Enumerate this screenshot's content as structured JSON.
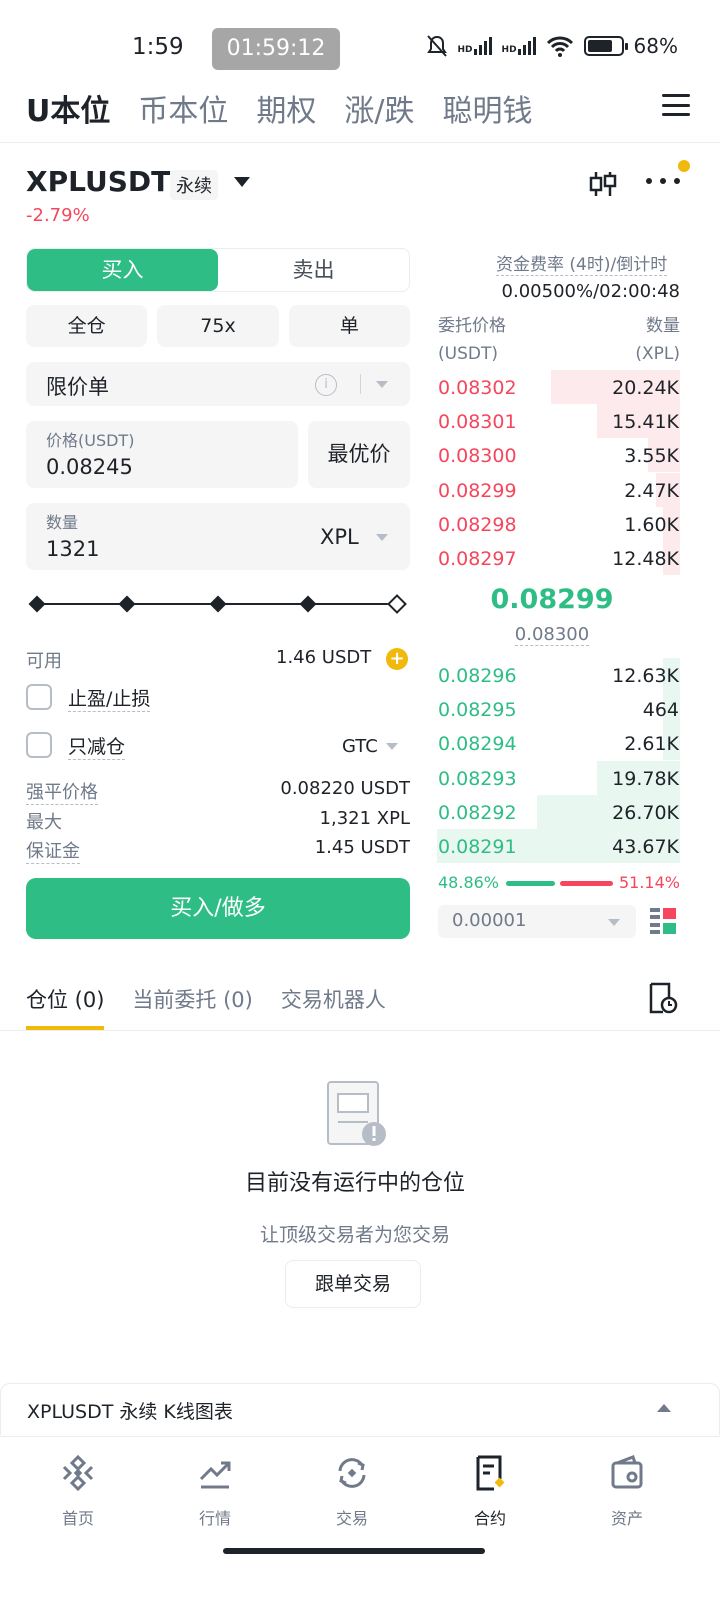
{
  "status_bar": {
    "time": "1:59",
    "timer": "01:59:12",
    "signal1": "HD",
    "signal2": "HD",
    "battery": "68%"
  },
  "top_nav": {
    "tabs": [
      "U本位",
      "币本位",
      "期权",
      "涨/跌",
      "聪明钱"
    ],
    "active_index": 0
  },
  "symbol": {
    "name": "XPLUSDT",
    "badge": "永续",
    "change": "-2.79%"
  },
  "order_form": {
    "buy_label": "买入",
    "sell_label": "卖出",
    "margin_mode": "全仓",
    "leverage": "75x",
    "position_mode": "单",
    "order_type": "限价单",
    "price_label": "价格(USDT)",
    "price_value": "0.08245",
    "best_price_label": "最优价",
    "qty_label": "数量",
    "qty_value": "1321",
    "qty_unit": "XPL",
    "slider_percent": 100,
    "available_label": "可用",
    "available_value": "1.46 USDT",
    "tpsl_label": "止盈/止损",
    "reduce_only_label": "只减仓",
    "tif": "GTC",
    "liq_label": "强平价格",
    "liq_value": "0.08220 USDT",
    "max_label": "最大",
    "max_value": "1,321 XPL",
    "margin_label": "保证金",
    "margin_value": "1.45 USDT",
    "submit_label": "买入/做多"
  },
  "orderbook": {
    "funding_label": "资金费率 (4时)/倒计时",
    "funding_value": "0.00500%/02:00:48",
    "price_header": "委托价格",
    "price_unit": "(USDT)",
    "qty_header": "数量",
    "qty_unit": "(XPL)",
    "asks": [
      {
        "price": "0.08302",
        "qty": "20.24K",
        "depth": 0.53
      },
      {
        "price": "0.08301",
        "qty": "15.41K",
        "depth": 0.34
      },
      {
        "price": "0.08300",
        "qty": "3.55K",
        "depth": 0.13
      },
      {
        "price": "0.08299",
        "qty": "2.47K",
        "depth": 0.1
      },
      {
        "price": "0.08298",
        "qty": "1.60K",
        "depth": 0.07
      },
      {
        "price": "0.08297",
        "qty": "12.48K",
        "depth": 0.07
      }
    ],
    "last_price": "0.08299",
    "mark_price": "0.08300",
    "bids": [
      {
        "price": "0.08296",
        "qty": "12.63K",
        "depth": 0.07
      },
      {
        "price": "0.08295",
        "qty": "464",
        "depth": 0.07
      },
      {
        "price": "0.08294",
        "qty": "2.61K",
        "depth": 0.07
      },
      {
        "price": "0.08293",
        "qty": "19.78K",
        "depth": 0.34
      },
      {
        "price": "0.08292",
        "qty": "26.70K",
        "depth": 0.59
      },
      {
        "price": "0.08291",
        "qty": "43.67K",
        "depth": 1.0
      }
    ],
    "buy_ratio": "48.86%",
    "sell_ratio": "51.14%",
    "precision": "0.00001"
  },
  "positions": {
    "tabs": [
      "仓位 (0)",
      "当前委托 (0)",
      "交易机器人"
    ],
    "empty_title": "目前没有运行中的仓位",
    "empty_sub": "让顶级交易者为您交易",
    "copy_button": "跟单交易"
  },
  "kline_bar": {
    "label": "XPLUSDT 永续 K线图表"
  },
  "bottom_nav": {
    "items": [
      "首页",
      "行情",
      "交易",
      "合约",
      "资产"
    ],
    "active_index": 3
  },
  "colors": {
    "buy": "#2ebd85",
    "sell": "#f6465d",
    "accent": "#f0b90b"
  }
}
